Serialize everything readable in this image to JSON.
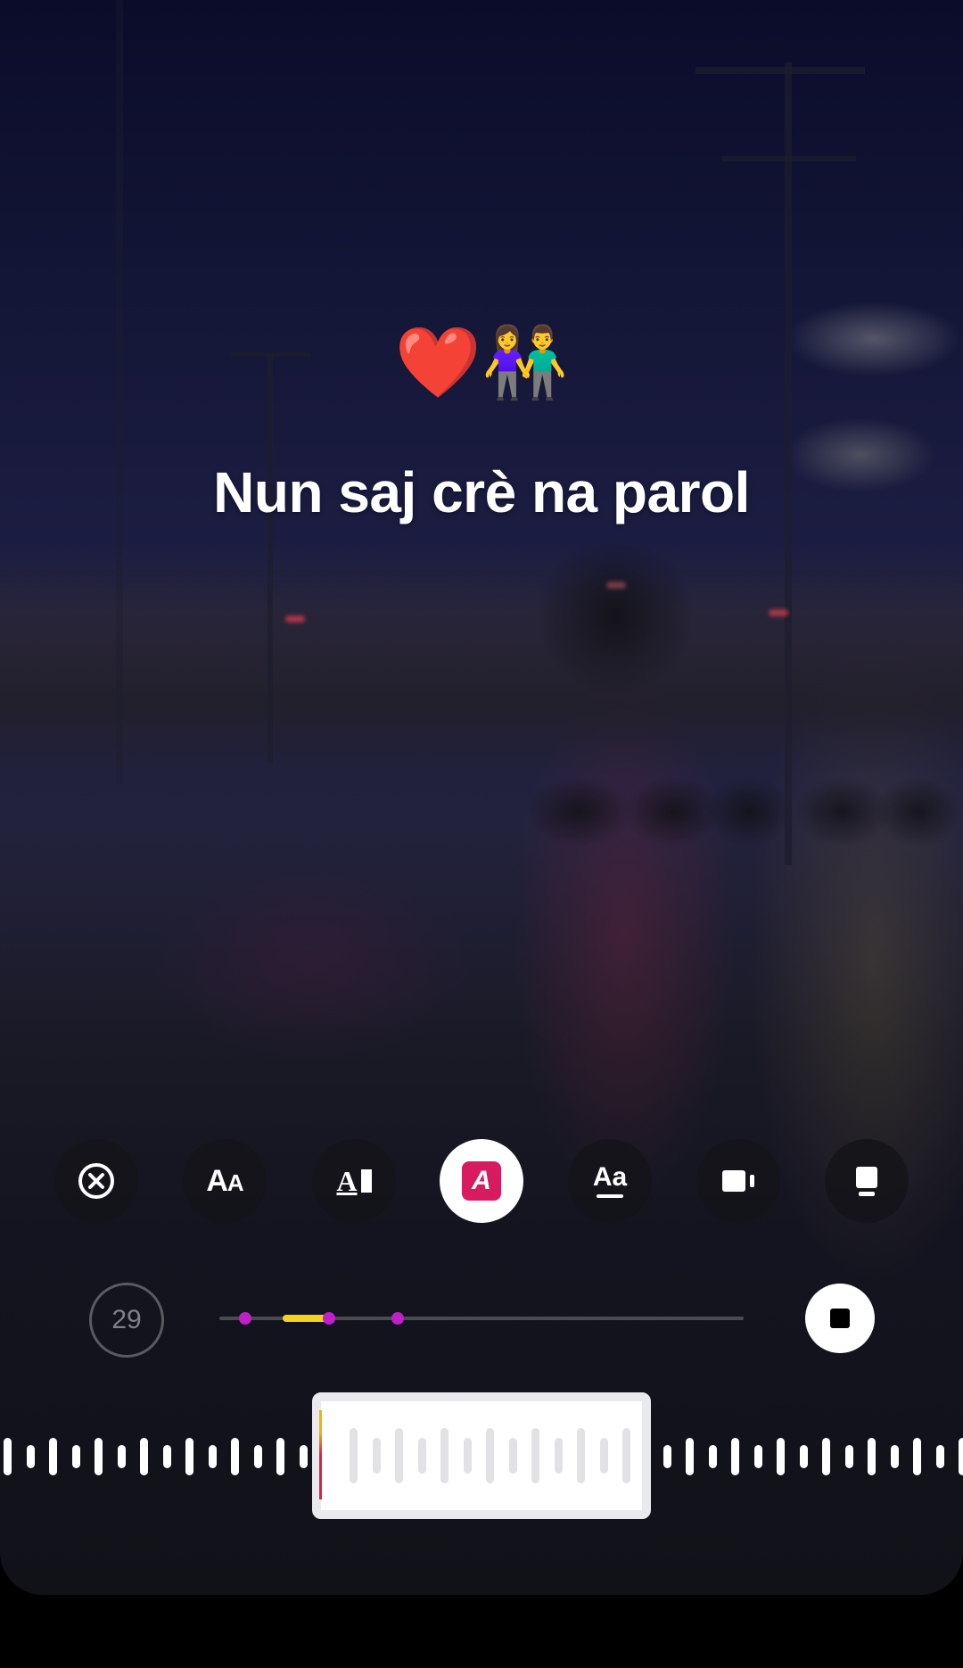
{
  "overlay": {
    "emoji": "❤️👫",
    "caption": "Nun saj crè na parol"
  },
  "toolbar": {
    "tools": [
      {
        "name": "close",
        "icon": "close-circle-icon"
      },
      {
        "name": "font",
        "icon": "font-size-icon",
        "label": "AA"
      },
      {
        "name": "text-style",
        "icon": "text-style-icon",
        "label": "A"
      },
      {
        "name": "color",
        "icon": "text-color-icon",
        "label": "A",
        "active": true
      },
      {
        "name": "animate",
        "icon": "animate-text-icon",
        "label": "Aa"
      },
      {
        "name": "effect",
        "icon": "effect-icon"
      },
      {
        "name": "layout",
        "icon": "layout-icon"
      }
    ]
  },
  "playback": {
    "time_label": "29",
    "progress_fraction": 0.21,
    "segment_start_fraction": 0.12,
    "markers": [
      0.05,
      0.21,
      0.34
    ],
    "stop_icon": "stop-icon"
  },
  "colors": {
    "accent_active": "#d81b60",
    "progress": "#f4d21d",
    "marker": "#c01fc9"
  }
}
